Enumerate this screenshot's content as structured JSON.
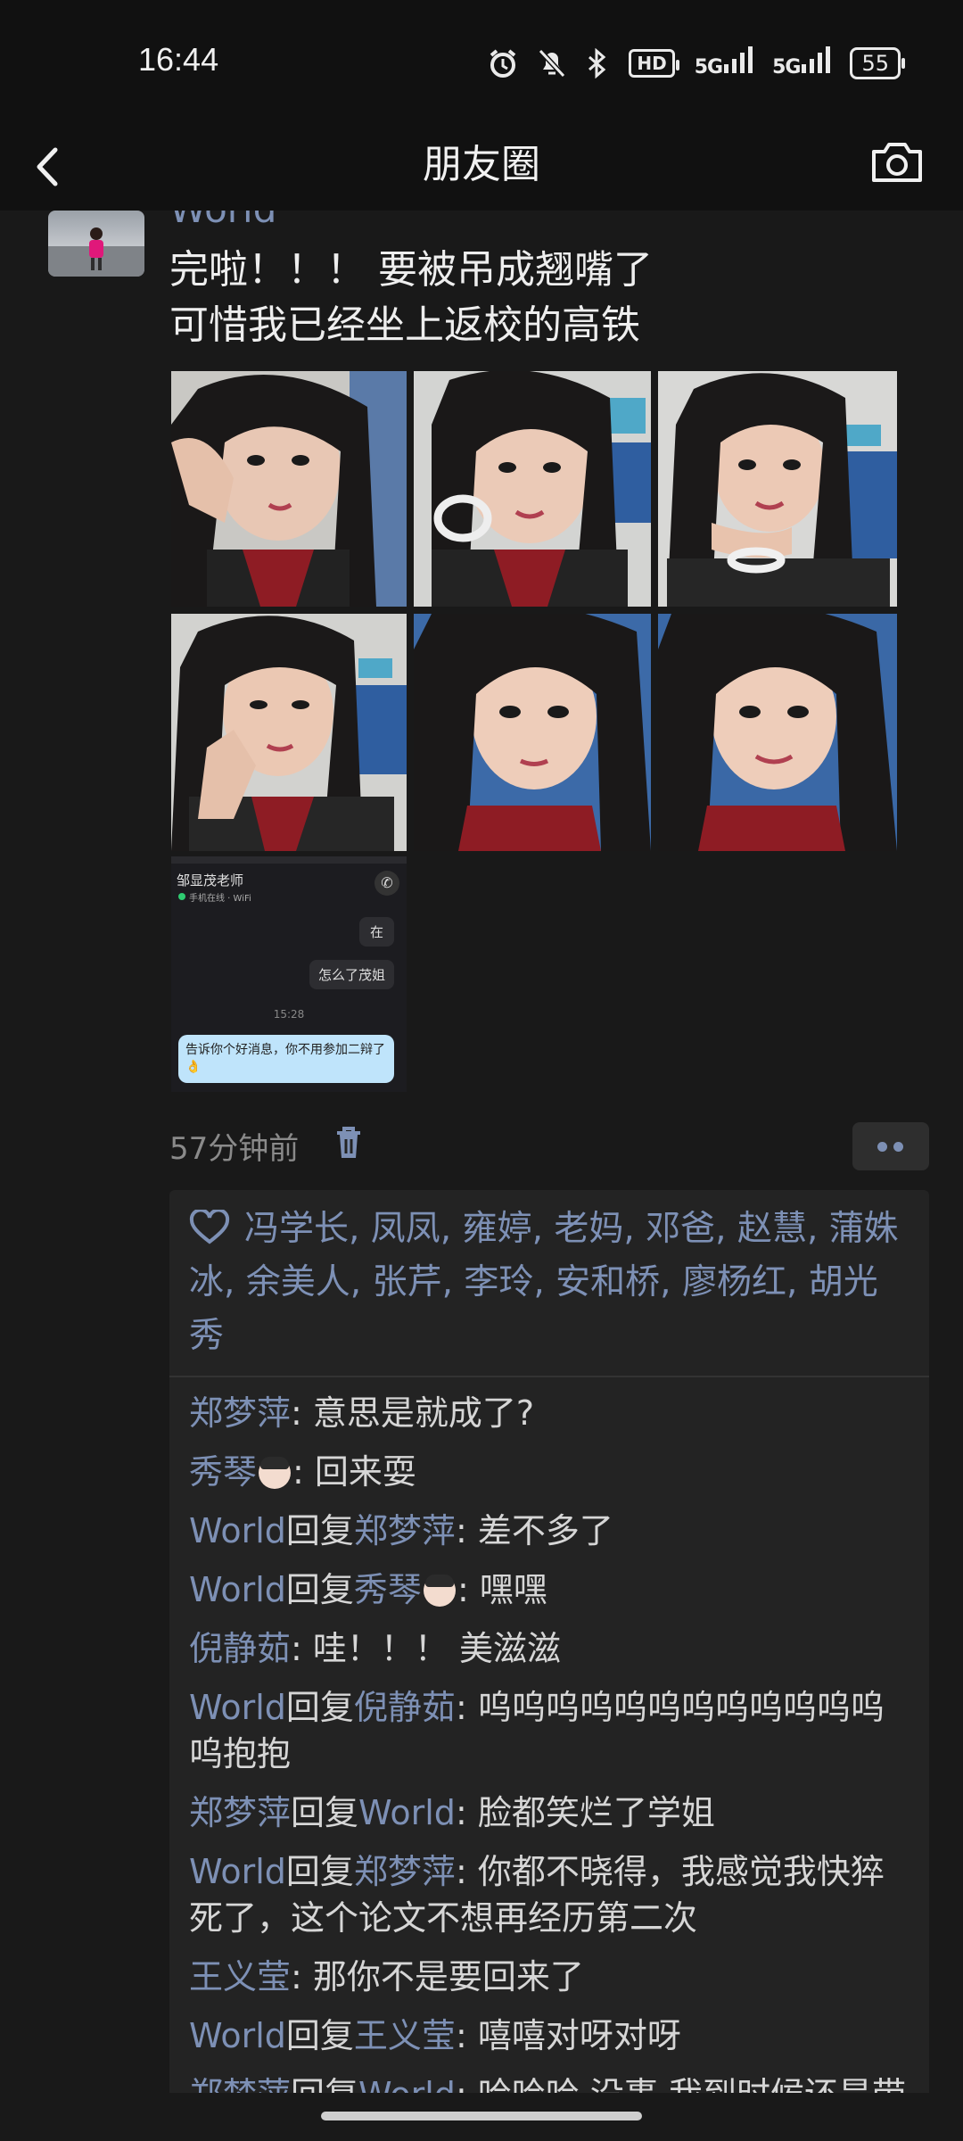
{
  "status_bar": {
    "time": "16:44",
    "icons": [
      "alarm-icon",
      "mute-icon",
      "bluetooth-icon",
      "hd-icon",
      "5g-signal-icon",
      "5g-signal-icon"
    ],
    "hd": "HD",
    "signal1": "5G",
    "signal2": "5G",
    "battery": "55"
  },
  "nav": {
    "title": "朋友圈",
    "back_icon": "back-chevron-icon",
    "camera_icon": "camera-icon"
  },
  "post": {
    "author": "World",
    "text": "完啦！！！ 要被吊成翘嘴了\n可惜我已经坐上返校的高铁",
    "photos": [
      {
        "name": "selfie-photo-1"
      },
      {
        "name": "selfie-photo-2"
      },
      {
        "name": "selfie-photo-3"
      },
      {
        "name": "selfie-photo-4"
      },
      {
        "name": "selfie-photo-5"
      },
      {
        "name": "selfie-photo-6"
      }
    ],
    "screenshot": {
      "contact": "邹显茂老师",
      "status": "手机在线 · WiFi",
      "msg1": "在",
      "msg2": "怎么了茂姐",
      "time": "15:28",
      "msg3": "告诉你个好消息，你不用参加二辩了👌"
    },
    "time_ago": "57分钟前"
  },
  "likes": "冯学长, 凤凤, 雍婷, 老妈, 邓爸, 赵慧, 蒲姝冰, 余美人, 张芹, 李玲, 安和桥, 廖杨红, 胡光秀",
  "comments": [
    {
      "name": "郑梦萍",
      "reply_word": "",
      "target": "",
      "text": ": 意思是就成了?"
    },
    {
      "name": "秀琴",
      "emoji": true,
      "reply_word": "",
      "target": "",
      "text": ": 回来耍"
    },
    {
      "name": "World",
      "reply_word": "回复",
      "target": "郑梦萍",
      "text": ": 差不多了"
    },
    {
      "name": "World",
      "reply_word": "回复",
      "target": "秀琴",
      "target_emoji": true,
      "text": ": 嘿嘿"
    },
    {
      "name": "倪静茹",
      "reply_word": "",
      "target": "",
      "text": ": 哇！！！ 美滋滋"
    },
    {
      "name": "World",
      "reply_word": "回复",
      "target": "倪静茹",
      "text": ": 呜呜呜呜呜呜呜呜呜呜呜呜呜抱抱"
    },
    {
      "name": "郑梦萍",
      "reply_word": "回复",
      "target": "World",
      "text": ": 脸都笑烂了学姐"
    },
    {
      "name": "World",
      "reply_word": "回复",
      "target": "郑梦萍",
      "text": ": 你都不晓得，我感觉我快猝死了，这个论文不想再经历第二次"
    },
    {
      "name": "王义莹",
      "reply_word": "",
      "target": "",
      "text": ": 那你不是要回来了"
    },
    {
      "name": "World",
      "reply_word": "回复",
      "target": "王义莹",
      "text": ": 嘻嘻对呀对呀"
    },
    {
      "name": "郑梦萍",
      "reply_word": "回复",
      "target": "World",
      "text": ": 哈哈哈 没事 我到时候还是带"
    }
  ]
}
